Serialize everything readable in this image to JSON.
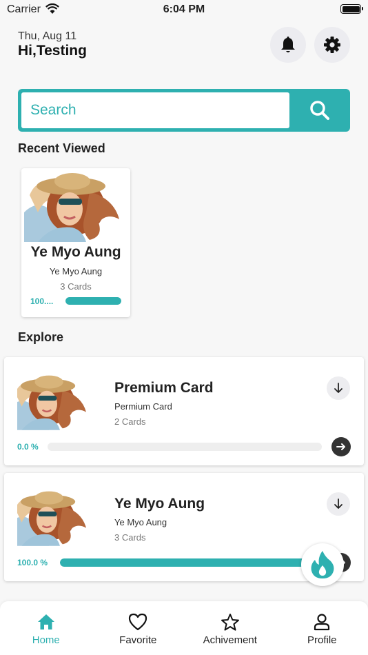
{
  "status_bar": {
    "carrier": "Carrier",
    "time": "6:04 PM"
  },
  "header": {
    "date": "Thu, Aug 11",
    "greeting": "Hi,Testing"
  },
  "search": {
    "placeholder": "Search"
  },
  "recent": {
    "title": "Recent Viewed",
    "items": [
      {
        "title": "Ye Myo Aung",
        "subtitle": "Ye Myo Aung",
        "count": "3 Cards",
        "progress_label": "100....",
        "progress": 1.0
      }
    ]
  },
  "explore": {
    "title": "Explore",
    "items": [
      {
        "title": "Premium Card",
        "subtitle": "Permium Card",
        "count": "2 Cards",
        "progress_label": "0.0 %",
        "progress": 0.0
      },
      {
        "title": "Ye Myo Aung",
        "subtitle": "Ye Myo Aung",
        "count": "3 Cards",
        "progress_label": "100.0 %",
        "progress": 1.0
      }
    ]
  },
  "nav": {
    "items": [
      {
        "label": "Home",
        "icon": "home-icon",
        "active": true
      },
      {
        "label": "Favorite",
        "icon": "heart-icon",
        "active": false
      },
      {
        "label": "Achivement",
        "icon": "star-icon",
        "active": false
      },
      {
        "label": "Profile",
        "icon": "person-icon",
        "active": false
      }
    ]
  },
  "colors": {
    "accent": "#2eb0b0",
    "text": "#222222",
    "background": "#f7f7f7"
  }
}
